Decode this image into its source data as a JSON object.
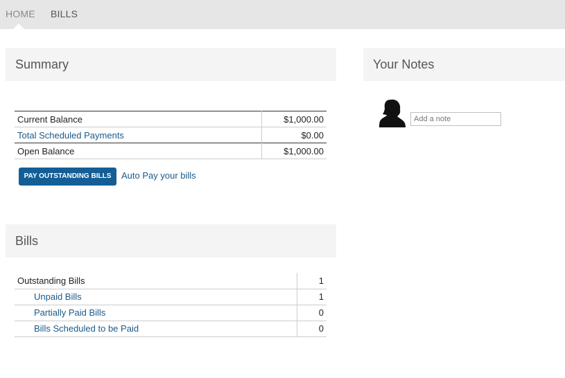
{
  "nav": {
    "home": "HOME",
    "bills": "BILLS"
  },
  "summary": {
    "title": "Summary",
    "rows": [
      {
        "label": "Current Balance",
        "value": "$1,000.00"
      },
      {
        "label": "Total Scheduled Payments",
        "value": "$0.00"
      },
      {
        "label": "Open Balance",
        "value": "$1,000.00"
      }
    ],
    "pay_button": "PAY OUTSTANDING BILLS",
    "autopay_link": "Auto Pay your bills"
  },
  "notes": {
    "title": "Your Notes",
    "placeholder": "Add a note",
    "avatar_icon": "person-silhouette-icon"
  },
  "bills": {
    "title": "Bills",
    "rows": [
      {
        "label": "Outstanding Bills",
        "value": "1"
      },
      {
        "label": "Unpaid Bills",
        "value": "1"
      },
      {
        "label": "Partially Paid Bills",
        "value": "0"
      },
      {
        "label": "Bills Scheduled to be Paid",
        "value": "0"
      }
    ]
  },
  "colors": {
    "link": "#1a5a8a",
    "button": "#135e96",
    "nav_bg": "#e6e6e6",
    "panel_bg": "#f4f4f4"
  }
}
